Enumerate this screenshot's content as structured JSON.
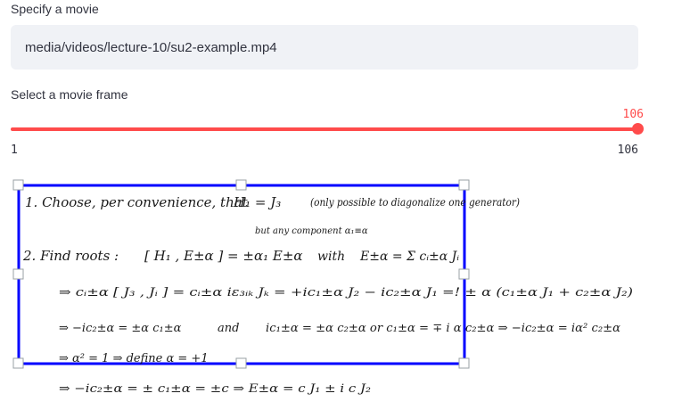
{
  "movie_input": {
    "label": "Specify a movie",
    "value": "media/videos/lecture-10/su2-example.mp4"
  },
  "frame_slider": {
    "label": "Select a movie frame",
    "value": "106",
    "min": "1",
    "max": "106"
  },
  "frame_image": {
    "lines": [
      "1. Choose, per convenience, that",
      "H₁ = J₃",
      "(only possible to diagonalize one generator)",
      "but any component α₁≡α",
      "2. Find roots :",
      "[ H₁ , E±α ] = ±α₁ E±α",
      "with",
      "E±α = Σ cᵢ±α Jᵢ",
      "⇒   cᵢ±α [ J₃ , Jᵢ ] = cᵢ±α iε₃ᵢₖ Jₖ = +ic₁±α J₂ − ic₂±α J₁  =!  ± α (c₁±α J₁ + c₂±α J₂)",
      "⇒  −ic₂±α = ±α c₁±α",
      "and",
      "ic₁±α = ±α c₂±α  or  c₁±α = ∓ i α c₂±α  ⇒  −ic₂±α = iα² c₂±α",
      "⇒ α² = 1  ⇒  define  α = +1",
      "⇒  −ic₂±α = ± c₁±α = ±c   ⇒  E±α = c J₁ ± i c J₂"
    ]
  }
}
